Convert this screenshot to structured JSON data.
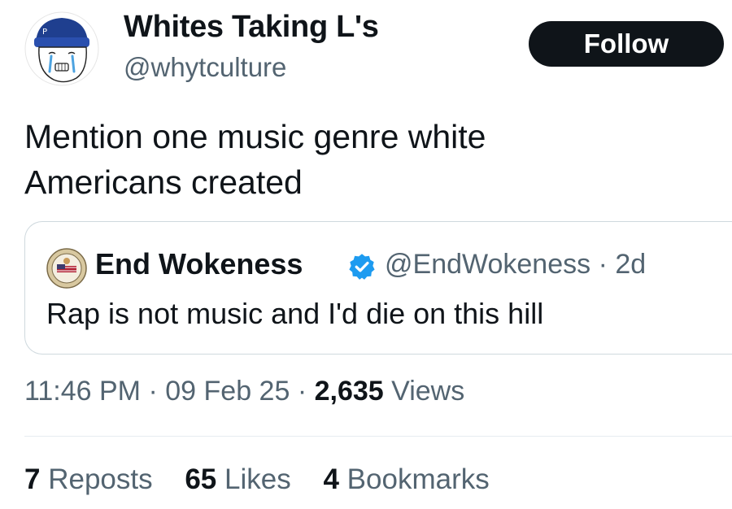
{
  "author": {
    "display_name": "Whites Taking L's",
    "handle": "@whytculture",
    "avatar_icon": "crying-wojak-beanie-avatar"
  },
  "follow_button": {
    "label": "Follow"
  },
  "tweet": {
    "text_line_1": "Mention one music genre white",
    "text_line_2": "Americans created"
  },
  "quote": {
    "display_name": "End Wokeness",
    "verified_icon": "verified-badge-icon",
    "handle": "@EndWokeness",
    "separator": "·",
    "age": "2d",
    "text": "Rap is not music and I'd die on this hill",
    "avatar_icon": "seal-avatar"
  },
  "meta": {
    "time": "11:46 PM",
    "date": "09 Feb 25",
    "separator": "·",
    "views_count": "2,635",
    "views_label": "Views"
  },
  "stats": {
    "reposts_count": "7",
    "reposts_label": "Reposts",
    "likes_count": "65",
    "likes_label": "Likes",
    "bookmarks_count": "4",
    "bookmarks_label": "Bookmarks"
  },
  "colors": {
    "text_primary": "#0f1419",
    "text_secondary": "#536471",
    "border": "#cfd9de",
    "verified_blue": "#1d9bf0",
    "button_bg": "#0f1419"
  }
}
